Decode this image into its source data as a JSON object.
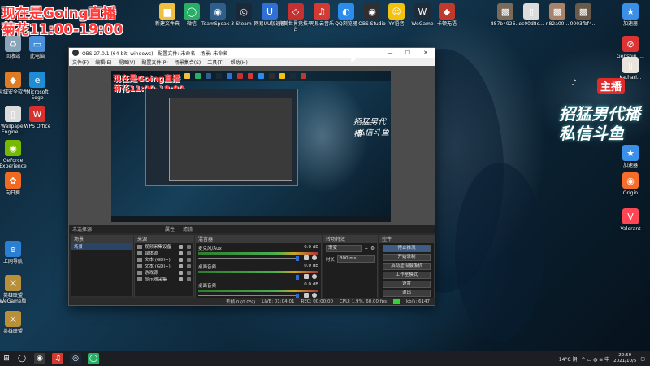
{
  "overlay": {
    "line1": "现在是Going直播",
    "line2": "菊花11:00-19:00",
    "preview_line1": "现在是Going直播",
    "preview_line2": "菊花11:00-19:00",
    "tiktok_glyph": "♪"
  },
  "promo": {
    "badge": "主播",
    "line1": "招猛男代播",
    "line2": "私信斗鱼",
    "preview_line1": "招猛男代播",
    "preview_line2": "私信斗鱼"
  },
  "desktop_left": [
    {
      "label": "回收站",
      "icon": "recycle-bin-icon",
      "color": "#8aa4b8",
      "glyph": "♻"
    },
    {
      "label": "此电脑",
      "icon": "this-pc-icon",
      "color": "#4a90d9",
      "glyph": "▭"
    },
    {
      "label": "火绒安全软件",
      "icon": "huorong-icon",
      "color": "#e07b22",
      "glyph": "◆"
    },
    {
      "label": "Microsoft Edge",
      "icon": "edge-icon",
      "color": "#1f8cd6",
      "glyph": "e"
    },
    {
      "label": "Wallpaper Engine:...",
      "icon": "document-icon",
      "color": "#dcdcdc",
      "glyph": "▯"
    },
    {
      "label": "WPS Office",
      "icon": "wps-icon",
      "color": "#d8302d",
      "glyph": "W"
    },
    {
      "label": "GeForce Experience",
      "icon": "geforce-icon",
      "color": "#76b900",
      "glyph": "◉"
    },
    {
      "label": "向日葵",
      "icon": "sunflower-icon",
      "color": "#f06b21",
      "glyph": "✿"
    },
    {
      "label": "上网导航",
      "icon": "ie-icon",
      "color": "#2a7ed3",
      "glyph": "e"
    },
    {
      "label": "英雄联盟 WeGame版",
      "icon": "lol-icon",
      "color": "#b8903a",
      "glyph": "⚔"
    },
    {
      "label": "英雄联盟",
      "icon": "lol-icon",
      "color": "#b8903a",
      "glyph": "⚔"
    }
  ],
  "desktop_top": [
    {
      "label": "新建文件夹",
      "icon": "folder-icon",
      "color": "#f0c040",
      "glyph": "▆"
    },
    {
      "label": "微信",
      "icon": "wechat-icon",
      "color": "#2aae67",
      "glyph": "◯"
    },
    {
      "label": "TeamSpeak 3",
      "icon": "teamspeak-icon",
      "color": "#2f5e8a",
      "glyph": "◉"
    },
    {
      "label": "Steam",
      "icon": "steam-icon",
      "color": "#1b2838",
      "glyph": "◎"
    },
    {
      "label": "网易UU加速器",
      "icon": "uu-icon",
      "color": "#2f6fd6",
      "glyph": "U"
    },
    {
      "label": "完美世界竞技平台",
      "icon": "perfectworld-icon",
      "color": "#c53030",
      "glyph": "◇"
    },
    {
      "label": "网易云音乐",
      "icon": "netease-music-icon",
      "color": "#d33a31",
      "glyph": "♫"
    },
    {
      "label": "QQ浏览器",
      "icon": "qq-browser-icon",
      "color": "#2b8cf0",
      "glyph": "◐"
    },
    {
      "label": "OBS Studio",
      "icon": "obs-icon",
      "color": "#302e31",
      "glyph": "◉"
    },
    {
      "label": "YY语音",
      "icon": "yy-icon",
      "color": "#f4c20d",
      "glyph": "☺"
    },
    {
      "label": "WeGame",
      "icon": "wegame-icon",
      "color": "#1e2c3a",
      "glyph": "W"
    },
    {
      "label": "卡顿无语",
      "icon": "app-icon",
      "color": "#c0392b",
      "glyph": "◆"
    },
    {
      "label": "887b4926...",
      "icon": "image-file-icon",
      "color": "#7a6a5a",
      "glyph": "▩"
    },
    {
      "label": "ec00d8c...",
      "icon": "document-icon",
      "color": "#dcdcdc",
      "glyph": "▯"
    },
    {
      "label": "n82a00...",
      "icon": "image-file-icon",
      "color": "#a7836a",
      "glyph": "▩"
    },
    {
      "label": "0003fbf4...",
      "icon": "image-file-icon",
      "color": "#6a5a4a",
      "glyph": "▩"
    }
  ],
  "desktop_right": [
    {
      "label": "加速器",
      "icon": "star-icon",
      "color": "#3a8fe8",
      "glyph": "★"
    },
    {
      "label": "Genshin I...",
      "icon": "block-icon",
      "color": "#d33",
      "glyph": "⊘"
    },
    {
      "label": "Kathari...",
      "icon": "app-icon",
      "color": "#e9e4dc",
      "glyph": "▯"
    },
    {
      "label": "加速器",
      "icon": "star-icon",
      "color": "#3a8fe8",
      "glyph": "★"
    },
    {
      "label": "Origin",
      "icon": "origin-icon",
      "color": "#f56c2d",
      "glyph": "◉"
    },
    {
      "label": "Valorant",
      "icon": "valorant-icon",
      "color": "#ff4655",
      "glyph": "V"
    }
  ],
  "obs": {
    "title": "OBS 27.0.1 (64-bit, windows) - 配置文件: 未命名 - 场景: 未命名",
    "menu": [
      "文件(F)",
      "编辑(E)",
      "视图(V)",
      "配置文件(P)",
      "场景集合(S)",
      "工具(T)",
      "帮助(H)"
    ],
    "no_source": "未选择源",
    "props": "属性",
    "filters": "滤镜",
    "scenes_title": "场景",
    "scene_item": "场景",
    "sources_title": "来源",
    "sources": [
      "视频采集设备",
      "媒体源",
      "文本 (GDI+)",
      "文本 (GDI+)",
      "游戏源",
      "显示器采集"
    ],
    "mixer_title": "混音器",
    "mixer": [
      {
        "name": "麦克风/Aux",
        "db": "0.0 dB"
      },
      {
        "name": "桌面音频",
        "db": "0.0 dB"
      },
      {
        "name": "桌面音频",
        "db": "0.0 dB"
      }
    ],
    "trans_title": "转场特效",
    "trans_value": "渐变",
    "duration_label": "时长",
    "duration_value": "300 ms",
    "controls_title": "控件",
    "buttons": [
      "停止推流",
      "开始录制",
      "启动虚拟摄像机",
      "工作室模式",
      "设置",
      "退出"
    ],
    "status": {
      "dropped": "丢帧 0 (0.0%)",
      "live": "LIVE: 01:04:01",
      "rec": "REC: 00:00:00",
      "cpu": "CPU: 1.9%, 60.00 fps",
      "kbps": "kb/s: 6147"
    },
    "win_controls": [
      "—",
      "☐",
      "✕"
    ]
  },
  "taskbar": {
    "apps": [
      {
        "icon": "start-icon",
        "glyph": "⊞",
        "color": "#1b1f24"
      },
      {
        "icon": "search-icon",
        "glyph": "◯",
        "color": "#1b1f24"
      },
      {
        "icon": "obs-icon",
        "glyph": "◉",
        "color": "#3a3a3a"
      },
      {
        "icon": "netease-music-icon",
        "glyph": "♫",
        "color": "#d33a31"
      },
      {
        "icon": "steam-icon",
        "glyph": "◎",
        "color": "#1b2838"
      },
      {
        "icon": "wechat-icon",
        "glyph": "◯",
        "color": "#2aae67"
      }
    ],
    "weather": "14°C 阴",
    "tray_glyphs": "^ ▭ ◍ ≡ 中",
    "time": "22:59",
    "date": "2021/10/5"
  }
}
